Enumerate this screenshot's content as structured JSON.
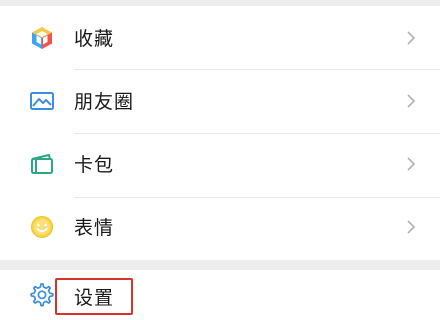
{
  "menu": {
    "items": [
      {
        "label": "收藏",
        "icon": "favorites-cube-icon"
      },
      {
        "label": "朋友圈",
        "icon": "moments-picture-icon"
      },
      {
        "label": "卡包",
        "icon": "card-wallet-icon"
      },
      {
        "label": "表情",
        "icon": "sticker-smile-icon"
      }
    ],
    "settings": {
      "label": "设置",
      "icon": "settings-gear-icon"
    }
  },
  "colors": {
    "highlight": "#d9342b",
    "background": "#ededed"
  }
}
